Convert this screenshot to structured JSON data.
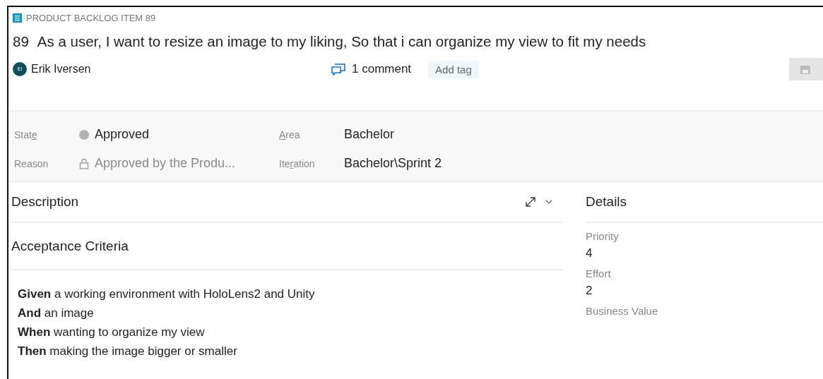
{
  "work_item": {
    "type_label": "PRODUCT BACKLOG ITEM 89",
    "id": "89",
    "title": "As a user, I want to resize an image to my liking, So that i can organize my view to fit my needs"
  },
  "header": {
    "assignee": {
      "initials": "EI",
      "name": "Erik Iversen"
    },
    "comments": "1 comment",
    "add_tag": "Add tag",
    "save_disabled": true
  },
  "fields": [
    {
      "label_start": "Stat",
      "access_key": "e",
      "value": "Approved",
      "kind": "state",
      "locked": false,
      "color": "#b2b2b2"
    },
    {
      "access_key": "A",
      "label_end": "rea",
      "value": "Bachelor",
      "kind": "text",
      "locked": false
    },
    {
      "label_start": "Reason",
      "value": "Approved by the Produ...",
      "kind": "text",
      "locked": true
    },
    {
      "label_start": "Ite",
      "access_key": "r",
      "label_end": "ation",
      "value": "Bachelor\\Sprint 2",
      "kind": "text",
      "locked": false
    }
  ],
  "sections": [
    {
      "title": "Description",
      "expandable": true
    },
    {
      "title": "Acceptance Criteria",
      "expandable": false
    }
  ],
  "acceptance_criteria": [
    "**Given** a working environment with HoloLens2 and Unity",
    "**And** an image",
    "**When** wanting to organize my view",
    "**Then** making the image bigger or smaller"
  ],
  "details": {
    "title": "Details",
    "fields": [
      {
        "label": "Priority",
        "value": "4"
      },
      {
        "label": "Effort",
        "value": "2"
      },
      {
        "label": "Business Value"
      }
    ]
  }
}
